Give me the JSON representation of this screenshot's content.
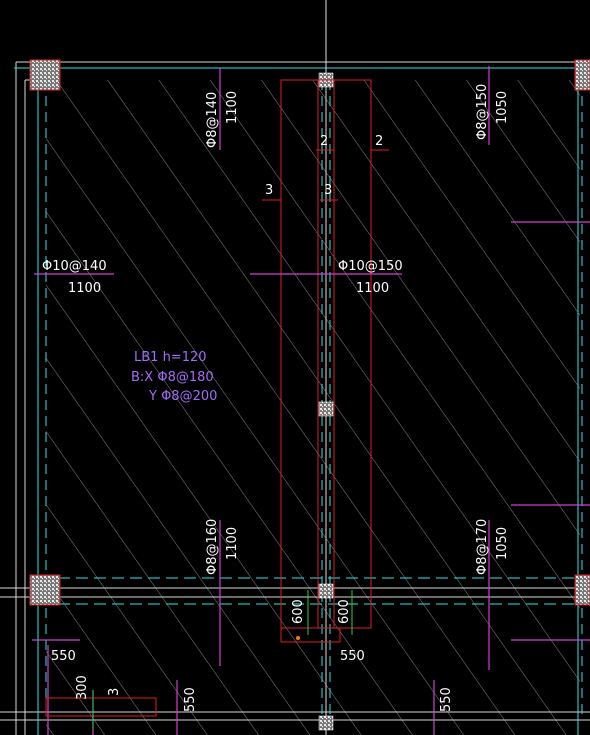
{
  "colors": {
    "background": "#000000",
    "hatch": "#c8c8c8",
    "wall": "#d8d8d8",
    "cyan": "#2ee6e6",
    "red": "#e01e1e",
    "magenta": "#d23ed2",
    "text": "#ffffff",
    "label_purple": "#a56cf5",
    "green": "#2ecc40"
  },
  "rebar_labels": {
    "top_left_spec": "Φ8@140",
    "top_left_len": "1100",
    "top_right_spec": "Φ8@150",
    "top_right_len": "1050",
    "mid_left_spec": "Φ10@140",
    "mid_left_len": "1100",
    "mid_center_spec": "Φ10@150",
    "mid_center_len": "1100",
    "bottom_left_spec": "Φ8@160",
    "bottom_left_len": "1100",
    "bottom_right_spec": "Φ8@170",
    "bottom_right_len": "1050",
    "bottom_550_left": "550",
    "bottom_550_center": "550",
    "bottom_550_v1": "550",
    "bottom_550_v2": "550",
    "bottom_300": "300"
  },
  "section_marks": {
    "mark_2a": "2",
    "mark_2b": "2",
    "mark_3a": "3",
    "mark_3b": "3",
    "mark_3c": "3"
  },
  "beam_dims": {
    "left": "600",
    "right": "600"
  },
  "slab_label": {
    "line1": "LB1 h=120",
    "line2": "B:X Φ8@180",
    "line3": "Y Φ8@200"
  }
}
